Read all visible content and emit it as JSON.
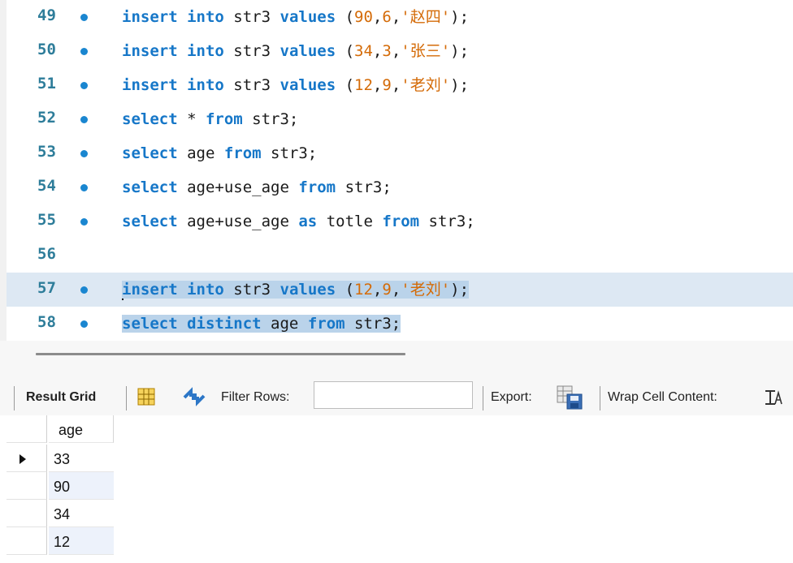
{
  "editor": {
    "lines": [
      {
        "no": "49",
        "dot": true,
        "tokens": [
          [
            "kw",
            "insert"
          ],
          [
            "id",
            " "
          ],
          [
            "kw",
            "into"
          ],
          [
            "id",
            " str3 "
          ],
          [
            "kw",
            "values"
          ],
          [
            "id",
            " ("
          ],
          [
            "num",
            "90"
          ],
          [
            "id",
            ","
          ],
          [
            "num",
            "6"
          ],
          [
            "id",
            ","
          ],
          [
            "str",
            "'赵四'"
          ],
          [
            "id",
            ");"
          ]
        ]
      },
      {
        "no": "50",
        "dot": true,
        "tokens": [
          [
            "kw",
            "insert"
          ],
          [
            "id",
            " "
          ],
          [
            "kw",
            "into"
          ],
          [
            "id",
            " str3 "
          ],
          [
            "kw",
            "values"
          ],
          [
            "id",
            " ("
          ],
          [
            "num",
            "34"
          ],
          [
            "id",
            ","
          ],
          [
            "num",
            "3"
          ],
          [
            "id",
            ","
          ],
          [
            "str",
            "'张三'"
          ],
          [
            "id",
            ");"
          ]
        ]
      },
      {
        "no": "51",
        "dot": true,
        "tokens": [
          [
            "kw",
            "insert"
          ],
          [
            "id",
            " "
          ],
          [
            "kw",
            "into"
          ],
          [
            "id",
            " str3 "
          ],
          [
            "kw",
            "values"
          ],
          [
            "id",
            " ("
          ],
          [
            "num",
            "12"
          ],
          [
            "id",
            ","
          ],
          [
            "num",
            "9"
          ],
          [
            "id",
            ","
          ],
          [
            "str",
            "'老刘'"
          ],
          [
            "id",
            ");"
          ]
        ]
      },
      {
        "no": "52",
        "dot": true,
        "tokens": [
          [
            "kw",
            "select"
          ],
          [
            "id",
            " * "
          ],
          [
            "kw",
            "from"
          ],
          [
            "id",
            " str3;"
          ]
        ]
      },
      {
        "no": "53",
        "dot": true,
        "tokens": [
          [
            "kw",
            "select"
          ],
          [
            "id",
            " age "
          ],
          [
            "kw",
            "from"
          ],
          [
            "id",
            " str3;"
          ]
        ]
      },
      {
        "no": "54",
        "dot": true,
        "tokens": [
          [
            "kw",
            "select"
          ],
          [
            "id",
            " age+use_age "
          ],
          [
            "kw",
            "from"
          ],
          [
            "id",
            " str3;"
          ]
        ]
      },
      {
        "no": "55",
        "dot": true,
        "tokens": [
          [
            "kw",
            "select"
          ],
          [
            "id",
            " age+use_age "
          ],
          [
            "kw",
            "as"
          ],
          [
            "id",
            " totle "
          ],
          [
            "kw",
            "from"
          ],
          [
            "id",
            " str3;"
          ]
        ]
      },
      {
        "no": "56",
        "dot": false,
        "tokens": []
      },
      {
        "no": "57",
        "dot": true,
        "tokens": [
          [
            "kw",
            "insert"
          ],
          [
            "id",
            " "
          ],
          [
            "kw",
            "into"
          ],
          [
            "id",
            " str3 "
          ],
          [
            "kw",
            "values"
          ],
          [
            "id",
            " ("
          ],
          [
            "num",
            "12"
          ],
          [
            "id",
            ","
          ],
          [
            "num",
            "9"
          ],
          [
            "id",
            ","
          ],
          [
            "str",
            "'老刘'"
          ],
          [
            "id",
            ");"
          ]
        ]
      },
      {
        "no": "58",
        "dot": true,
        "tokens": [
          [
            "kw",
            "select"
          ],
          [
            "id",
            " "
          ],
          [
            "kw",
            "distinct"
          ],
          [
            "id",
            " age "
          ],
          [
            "kw",
            "from"
          ],
          [
            "id",
            " str3;"
          ]
        ]
      }
    ]
  },
  "toolbar": {
    "result_grid": "Result Grid",
    "filter_rows": "Filter Rows:",
    "export": "Export:",
    "wrap_cell": "Wrap Cell Content:",
    "filter_value": ""
  },
  "grid": {
    "columns": [
      "age"
    ],
    "rows": [
      "33",
      "90",
      "34",
      "12"
    ]
  },
  "colors": {
    "keyword": "#1677c8",
    "number": "#d46b08",
    "selection": "#bad3ea"
  }
}
